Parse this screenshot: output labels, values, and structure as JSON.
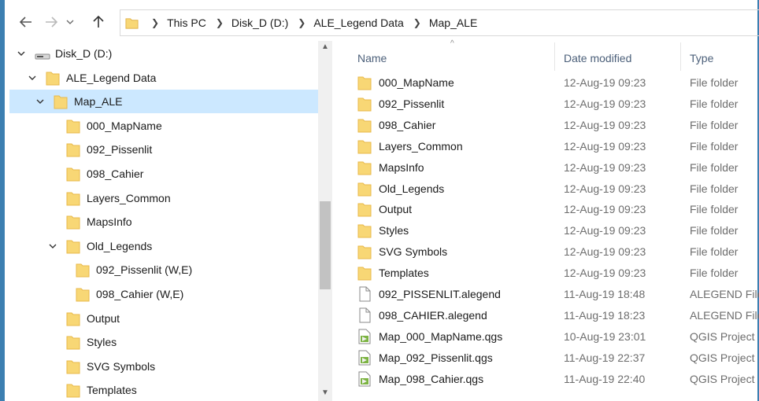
{
  "nav": {
    "back_icon": "back-arrow-icon",
    "forward_icon": "forward-arrow-icon",
    "recent_icon": "chevron-down-icon",
    "up_icon": "up-arrow-icon"
  },
  "breadcrumb": [
    "This PC",
    "Disk_D (D:)",
    "ALE_Legend Data",
    "Map_ALE"
  ],
  "tree": [
    {
      "label": "Disk_D (D:)",
      "level": 0,
      "expanded": true,
      "icon": "drive-icon"
    },
    {
      "label": "ALE_Legend Data",
      "level": 1,
      "expanded": true,
      "icon": "folder-icon"
    },
    {
      "label": "Map_ALE",
      "level": 2,
      "expanded": true,
      "selected": true,
      "icon": "folder-icon"
    },
    {
      "label": "000_MapName",
      "level": 3,
      "icon": "folder-icon"
    },
    {
      "label": "092_Pissenlit",
      "level": 3,
      "icon": "folder-icon"
    },
    {
      "label": "098_Cahier",
      "level": 3,
      "icon": "folder-icon"
    },
    {
      "label": "Layers_Common",
      "level": 3,
      "icon": "folder-icon"
    },
    {
      "label": "MapsInfo",
      "level": 3,
      "icon": "folder-icon"
    },
    {
      "label": "Old_Legends",
      "level": 3,
      "expanded": true,
      "icon": "folder-icon"
    },
    {
      "label": "092_Pissenlit (W,E)",
      "level": 4,
      "icon": "folder-icon"
    },
    {
      "label": "098_Cahier (W,E)",
      "level": 4,
      "icon": "folder-icon"
    },
    {
      "label": "Output",
      "level": 3,
      "icon": "folder-icon"
    },
    {
      "label": "Styles",
      "level": 3,
      "icon": "folder-icon"
    },
    {
      "label": "SVG Symbols",
      "level": 3,
      "icon": "folder-icon"
    },
    {
      "label": "Templates",
      "level": 3,
      "icon": "folder-icon"
    }
  ],
  "columns": {
    "name": "Name",
    "date": "Date modified",
    "type": "Type"
  },
  "files": [
    {
      "name": "000_MapName",
      "date": "12-Aug-19 09:23",
      "type": "File folder",
      "icon": "folder-icon"
    },
    {
      "name": "092_Pissenlit",
      "date": "12-Aug-19 09:23",
      "type": "File folder",
      "icon": "folder-icon"
    },
    {
      "name": "098_Cahier",
      "date": "12-Aug-19 09:23",
      "type": "File folder",
      "icon": "folder-icon"
    },
    {
      "name": "Layers_Common",
      "date": "12-Aug-19 09:23",
      "type": "File folder",
      "icon": "folder-icon"
    },
    {
      "name": "MapsInfo",
      "date": "12-Aug-19 09:23",
      "type": "File folder",
      "icon": "folder-icon"
    },
    {
      "name": "Old_Legends",
      "date": "12-Aug-19 09:23",
      "type": "File folder",
      "icon": "folder-icon"
    },
    {
      "name": "Output",
      "date": "12-Aug-19 09:23",
      "type": "File folder",
      "icon": "folder-icon"
    },
    {
      "name": "Styles",
      "date": "12-Aug-19 09:23",
      "type": "File folder",
      "icon": "folder-icon"
    },
    {
      "name": "SVG Symbols",
      "date": "12-Aug-19 09:23",
      "type": "File folder",
      "icon": "folder-icon"
    },
    {
      "name": "Templates",
      "date": "12-Aug-19 09:23",
      "type": "File folder",
      "icon": "folder-icon"
    },
    {
      "name": "092_PISSENLIT.alegend",
      "date": "11-Aug-19 18:48",
      "type": "ALEGEND File",
      "icon": "document-icon"
    },
    {
      "name": "098_CAHIER.alegend",
      "date": "11-Aug-19 18:23",
      "type": "ALEGEND File",
      "icon": "document-icon"
    },
    {
      "name": "Map_000_MapName.qgs",
      "date": "10-Aug-19 23:01",
      "type": "QGIS Project",
      "icon": "qgis-project-icon"
    },
    {
      "name": "Map_092_Pissenlit.qgs",
      "date": "11-Aug-19 22:37",
      "type": "QGIS Project",
      "icon": "qgis-project-icon"
    },
    {
      "name": "Map_098_Cahier.qgs",
      "date": "11-Aug-19 22:40",
      "type": "QGIS Project",
      "icon": "qgis-project-icon"
    }
  ],
  "colors": {
    "folder": "#f8d775",
    "folder_dark": "#e8b94a",
    "selection": "#cce8ff",
    "window_border": "#3c7fb1",
    "header_text": "#4c607a"
  }
}
